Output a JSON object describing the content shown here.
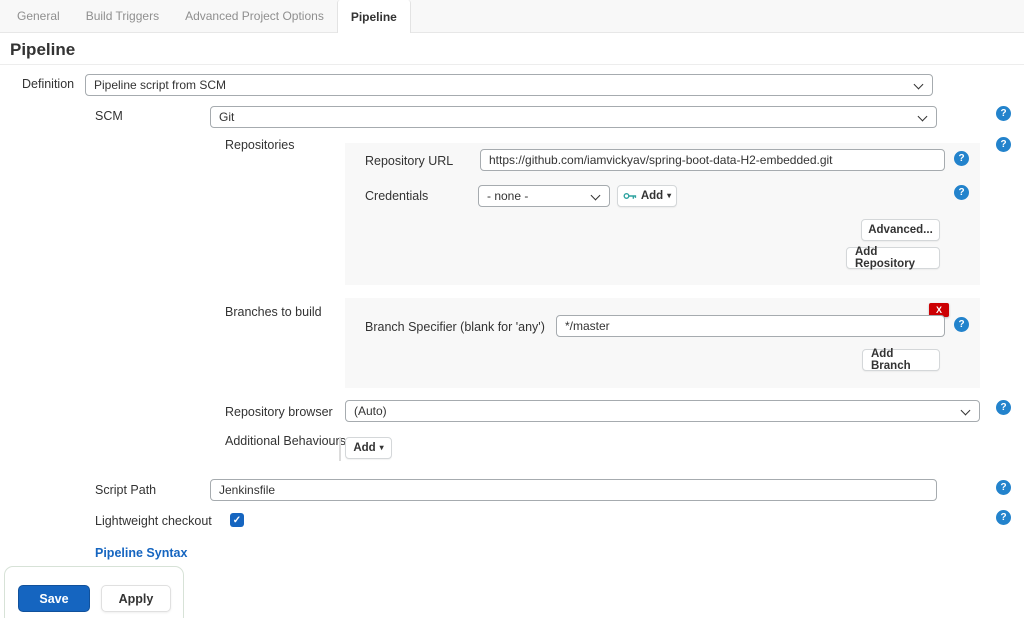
{
  "colors": {
    "accent_blue": "#1565c0",
    "help_blue": "#2383cc",
    "danger_red": "#cc0003",
    "link_blue": "#1565c0",
    "key_teal": "#2fa3a0"
  },
  "tabs": {
    "items": [
      {
        "label": "General"
      },
      {
        "label": "Build Triggers"
      },
      {
        "label": "Advanced Project Options"
      },
      {
        "label": "Pipeline"
      }
    ],
    "active_index": 3
  },
  "page": {
    "title": "Pipeline"
  },
  "form": {
    "definition": {
      "label": "Definition",
      "value": "Pipeline script from SCM"
    },
    "scm": {
      "label": "SCM",
      "value": "Git"
    },
    "repositories": {
      "label": "Repositories",
      "repository_url": {
        "label": "Repository URL",
        "value": "https://github.com/iamvickyav/spring-boot-data-H2-embedded.git"
      },
      "credentials": {
        "label": "Credentials",
        "value": "- none -",
        "add_button": "Add"
      },
      "advanced_button": "Advanced...",
      "add_repository_button": "Add Repository"
    },
    "branches": {
      "label": "Branches to build",
      "branch_specifier": {
        "label": "Branch Specifier (blank for 'any')",
        "value": "*/master"
      },
      "delete_button": "X",
      "add_branch_button": "Add Branch"
    },
    "repository_browser": {
      "label": "Repository browser",
      "value": "(Auto)"
    },
    "additional_behaviours": {
      "label": "Additional Behaviours",
      "add_button": "Add"
    },
    "script_path": {
      "label": "Script Path",
      "value": "Jenkinsfile"
    },
    "lightweight_checkout": {
      "label": "Lightweight checkout",
      "checked": true
    },
    "pipeline_syntax_link": "Pipeline Syntax"
  },
  "footer": {
    "save_button": "Save",
    "apply_button": "Apply"
  },
  "icons": {
    "help_glyph": "?",
    "check_glyph": "✓"
  }
}
